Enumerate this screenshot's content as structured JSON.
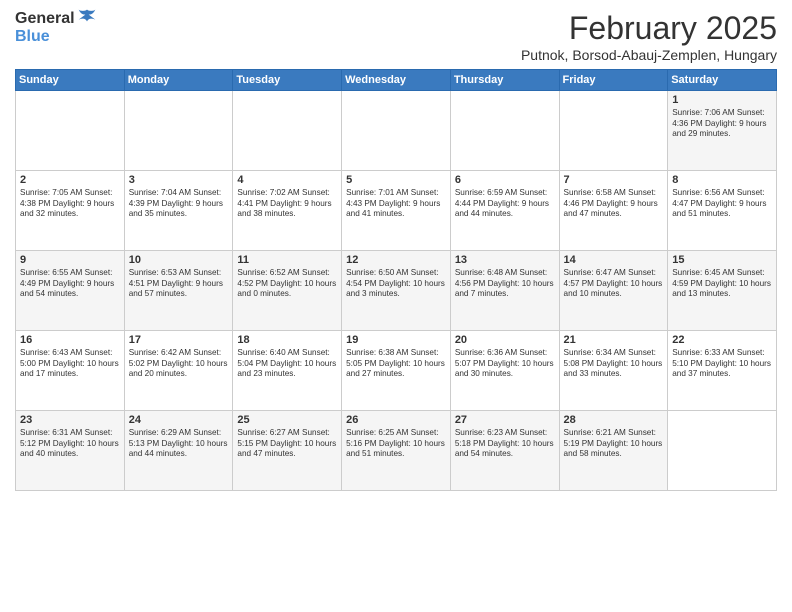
{
  "logo": {
    "general": "General",
    "blue": "Blue"
  },
  "header": {
    "title": "February 2025",
    "subtitle": "Putnok, Borsod-Abauj-Zemplen, Hungary"
  },
  "weekdays": [
    "Sunday",
    "Monday",
    "Tuesday",
    "Wednesday",
    "Thursday",
    "Friday",
    "Saturday"
  ],
  "weeks": [
    [
      {
        "day": "",
        "info": ""
      },
      {
        "day": "",
        "info": ""
      },
      {
        "day": "",
        "info": ""
      },
      {
        "day": "",
        "info": ""
      },
      {
        "day": "",
        "info": ""
      },
      {
        "day": "",
        "info": ""
      },
      {
        "day": "1",
        "info": "Sunrise: 7:06 AM\nSunset: 4:36 PM\nDaylight: 9 hours and 29 minutes."
      }
    ],
    [
      {
        "day": "2",
        "info": "Sunrise: 7:05 AM\nSunset: 4:38 PM\nDaylight: 9 hours and 32 minutes."
      },
      {
        "day": "3",
        "info": "Sunrise: 7:04 AM\nSunset: 4:39 PM\nDaylight: 9 hours and 35 minutes."
      },
      {
        "day": "4",
        "info": "Sunrise: 7:02 AM\nSunset: 4:41 PM\nDaylight: 9 hours and 38 minutes."
      },
      {
        "day": "5",
        "info": "Sunrise: 7:01 AM\nSunset: 4:43 PM\nDaylight: 9 hours and 41 minutes."
      },
      {
        "day": "6",
        "info": "Sunrise: 6:59 AM\nSunset: 4:44 PM\nDaylight: 9 hours and 44 minutes."
      },
      {
        "day": "7",
        "info": "Sunrise: 6:58 AM\nSunset: 4:46 PM\nDaylight: 9 hours and 47 minutes."
      },
      {
        "day": "8",
        "info": "Sunrise: 6:56 AM\nSunset: 4:47 PM\nDaylight: 9 hours and 51 minutes."
      }
    ],
    [
      {
        "day": "9",
        "info": "Sunrise: 6:55 AM\nSunset: 4:49 PM\nDaylight: 9 hours and 54 minutes."
      },
      {
        "day": "10",
        "info": "Sunrise: 6:53 AM\nSunset: 4:51 PM\nDaylight: 9 hours and 57 minutes."
      },
      {
        "day": "11",
        "info": "Sunrise: 6:52 AM\nSunset: 4:52 PM\nDaylight: 10 hours and 0 minutes."
      },
      {
        "day": "12",
        "info": "Sunrise: 6:50 AM\nSunset: 4:54 PM\nDaylight: 10 hours and 3 minutes."
      },
      {
        "day": "13",
        "info": "Sunrise: 6:48 AM\nSunset: 4:56 PM\nDaylight: 10 hours and 7 minutes."
      },
      {
        "day": "14",
        "info": "Sunrise: 6:47 AM\nSunset: 4:57 PM\nDaylight: 10 hours and 10 minutes."
      },
      {
        "day": "15",
        "info": "Sunrise: 6:45 AM\nSunset: 4:59 PM\nDaylight: 10 hours and 13 minutes."
      }
    ],
    [
      {
        "day": "16",
        "info": "Sunrise: 6:43 AM\nSunset: 5:00 PM\nDaylight: 10 hours and 17 minutes."
      },
      {
        "day": "17",
        "info": "Sunrise: 6:42 AM\nSunset: 5:02 PM\nDaylight: 10 hours and 20 minutes."
      },
      {
        "day": "18",
        "info": "Sunrise: 6:40 AM\nSunset: 5:04 PM\nDaylight: 10 hours and 23 minutes."
      },
      {
        "day": "19",
        "info": "Sunrise: 6:38 AM\nSunset: 5:05 PM\nDaylight: 10 hours and 27 minutes."
      },
      {
        "day": "20",
        "info": "Sunrise: 6:36 AM\nSunset: 5:07 PM\nDaylight: 10 hours and 30 minutes."
      },
      {
        "day": "21",
        "info": "Sunrise: 6:34 AM\nSunset: 5:08 PM\nDaylight: 10 hours and 33 minutes."
      },
      {
        "day": "22",
        "info": "Sunrise: 6:33 AM\nSunset: 5:10 PM\nDaylight: 10 hours and 37 minutes."
      }
    ],
    [
      {
        "day": "23",
        "info": "Sunrise: 6:31 AM\nSunset: 5:12 PM\nDaylight: 10 hours and 40 minutes."
      },
      {
        "day": "24",
        "info": "Sunrise: 6:29 AM\nSunset: 5:13 PM\nDaylight: 10 hours and 44 minutes."
      },
      {
        "day": "25",
        "info": "Sunrise: 6:27 AM\nSunset: 5:15 PM\nDaylight: 10 hours and 47 minutes."
      },
      {
        "day": "26",
        "info": "Sunrise: 6:25 AM\nSunset: 5:16 PM\nDaylight: 10 hours and 51 minutes."
      },
      {
        "day": "27",
        "info": "Sunrise: 6:23 AM\nSunset: 5:18 PM\nDaylight: 10 hours and 54 minutes."
      },
      {
        "day": "28",
        "info": "Sunrise: 6:21 AM\nSunset: 5:19 PM\nDaylight: 10 hours and 58 minutes."
      },
      {
        "day": "",
        "info": ""
      }
    ]
  ]
}
